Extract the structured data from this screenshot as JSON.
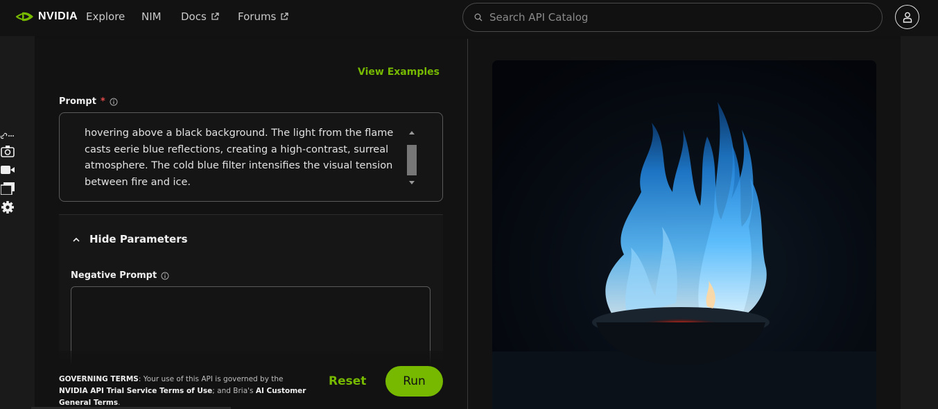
{
  "nav": {
    "brand": "NVIDIA",
    "links": [
      "Explore",
      "NIM",
      "Docs",
      "Forums"
    ],
    "search_placeholder": "Search API Catalog"
  },
  "rail": {
    "icons": [
      "link-icon",
      "camera-icon",
      "video-icon",
      "gallery-icon",
      "settings-icon"
    ]
  },
  "form": {
    "view_examples": "View Examples",
    "prompt_label": "Prompt",
    "required_mark": "*",
    "prompt_text": "hovering above a black background. The light from the flame casts eerie blue reflections, creating a high-contrast, surreal atmosphere. The cold blue filter intensifies the visual tension between fire and ice.",
    "hide_parameters": "Hide Parameters",
    "negative_prompt_label": "Negative Prompt",
    "negative_prompt_value": ""
  },
  "footer": {
    "terms_1": "GOVERNING TERMS",
    "terms_2": ": Your use of this API is governed by the ",
    "terms_3": "NVIDIA API Trial Service Terms of Use",
    "terms_4": "; and Bria's ",
    "terms_5": "AI Customer General Terms",
    "terms_6": ".",
    "reset": "Reset",
    "run": "Run"
  },
  "colors": {
    "accent": "#76b900",
    "flame": "#3ea0f0",
    "ember": "#ff4a2a"
  }
}
